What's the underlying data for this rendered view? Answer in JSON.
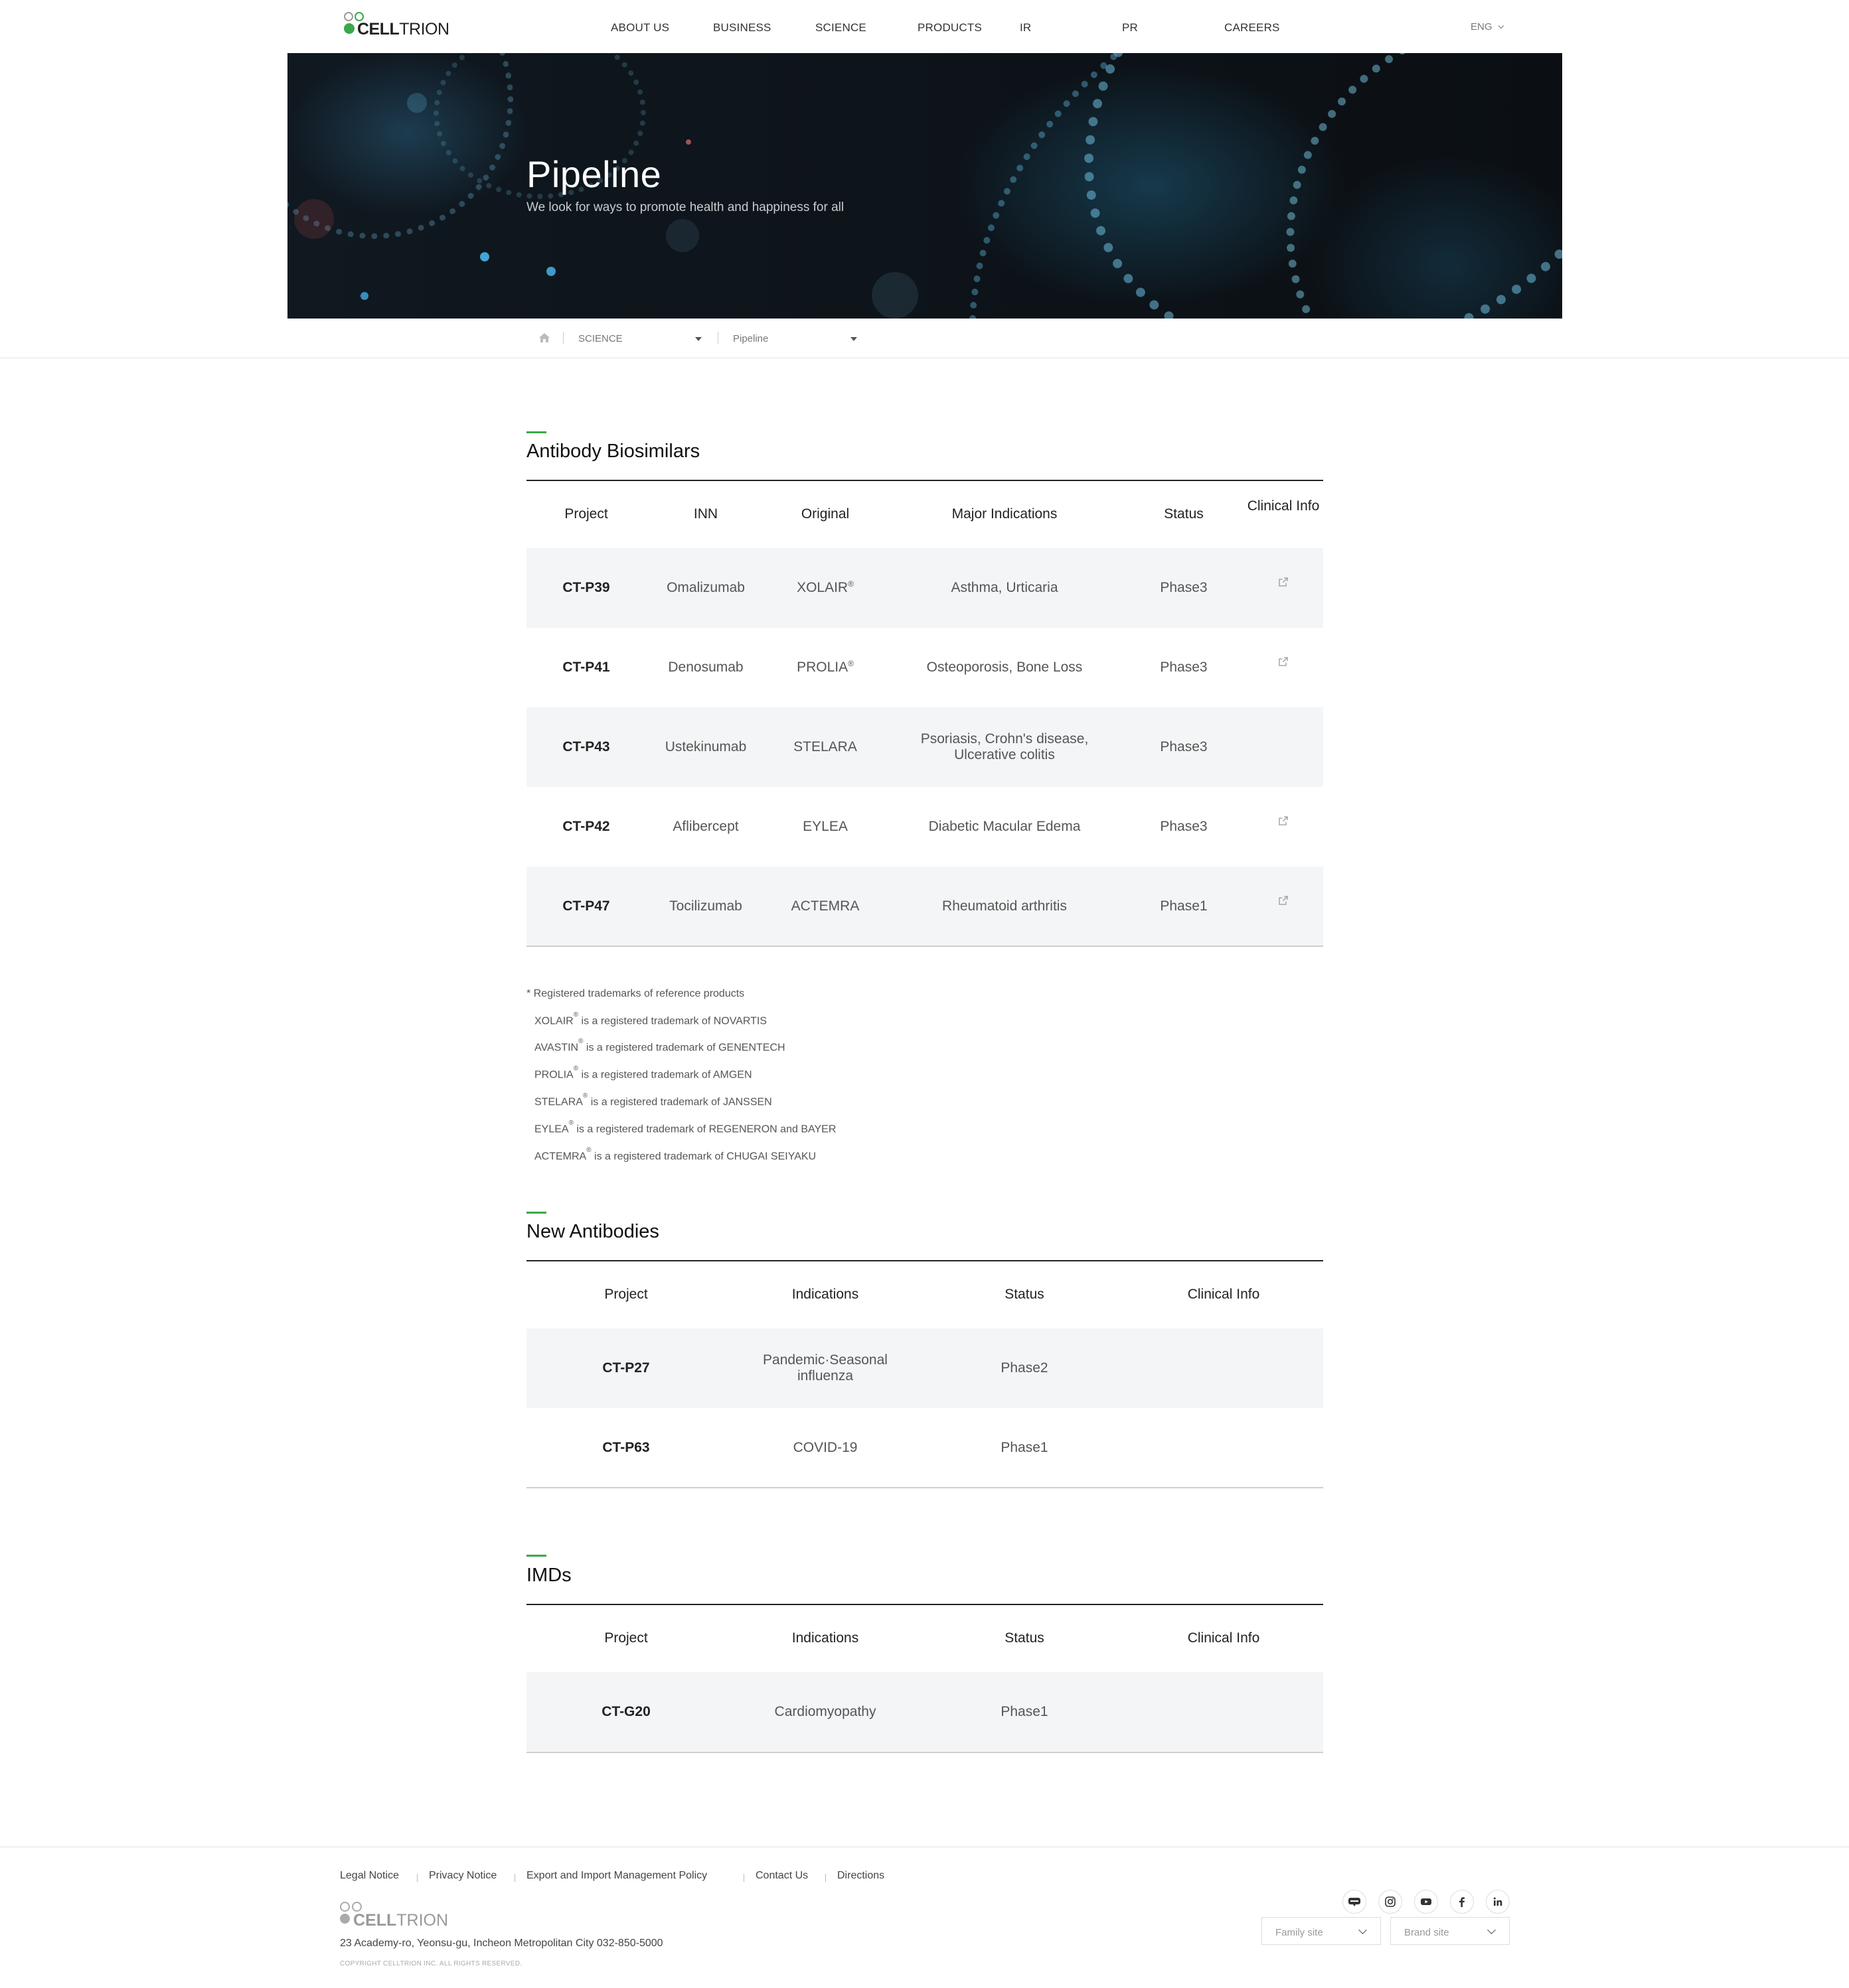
{
  "header": {
    "logo_text_bold": "CELL",
    "logo_text_light": "TRION",
    "nav": [
      "ABOUT US",
      "BUSINESS",
      "SCIENCE",
      "PRODUCTS",
      "IR",
      "PR",
      "CAREERS"
    ],
    "language": "ENG"
  },
  "hero": {
    "title": "Pipeline",
    "subtitle": "We look for ways to promote health and happiness for all"
  },
  "breadcrumb": {
    "level1": "SCIENCE",
    "level2": "Pipeline"
  },
  "biosimilars": {
    "title": "Antibody Biosimilars",
    "headers": [
      "Project",
      "INN",
      "Original",
      "Major Indications",
      "Status",
      "Clinical Info"
    ],
    "rows": [
      {
        "project": "CT-P39",
        "inn": "Omalizumab",
        "original": "XOLAIR",
        "reg": "®",
        "indications": "Asthma, Urticaria",
        "status": "Phase3",
        "clinical_link": true
      },
      {
        "project": "CT-P41",
        "inn": "Denosumab",
        "original": "PROLIA",
        "reg": "®",
        "indications": "Osteoporosis, Bone Loss",
        "status": "Phase3",
        "clinical_link": true
      },
      {
        "project": "CT-P43",
        "inn": "Ustekinumab",
        "original": "STELARA",
        "reg": "",
        "indications": "Psoriasis, Crohn's disease, Ulcerative colitis",
        "status": "Phase3",
        "clinical_link": false
      },
      {
        "project": "CT-P42",
        "inn": "Aflibercept",
        "original": "EYLEA",
        "reg": "",
        "indications": "Diabetic Macular Edema",
        "status": "Phase3",
        "clinical_link": true
      },
      {
        "project": "CT-P47",
        "inn": "Tocilizumab",
        "original": "ACTEMRA",
        "reg": "",
        "indications": "Rheumatoid arthritis",
        "status": "Phase1",
        "clinical_link": true
      }
    ]
  },
  "trademark_notes": {
    "heading": "* Registered trademarks of reference products",
    "lines": [
      {
        "brand": "XOLAIR",
        "text": " is a registered trademark of NOVARTIS"
      },
      {
        "brand": "AVASTIN",
        "text": " is a registered trademark of GENENTECH"
      },
      {
        "brand": "PROLIA",
        "text": " is a registered trademark of AMGEN"
      },
      {
        "brand": "STELARA",
        "text": " is a registered trademark of JANSSEN"
      },
      {
        "brand": "EYLEA",
        "text": " is a registered trademark of REGENERON and BAYER"
      },
      {
        "brand": "ACTEMRA",
        "text": " is a registered trademark of CHUGAI SEIYAKU"
      }
    ],
    "reg_mark": "®"
  },
  "new_antibodies": {
    "title": "New Antibodies",
    "headers": [
      "Project",
      "Indications",
      "Status",
      "Clinical Info"
    ],
    "rows": [
      {
        "project": "CT-P27",
        "indications": "Pandemic·Seasonal influenza",
        "status": "Phase2"
      },
      {
        "project": "CT-P63",
        "indications": "COVID-19",
        "status": "Phase1"
      }
    ]
  },
  "imds": {
    "title": "IMDs",
    "headers": [
      "Project",
      "Indications",
      "Status",
      "Clinical Info"
    ],
    "rows": [
      {
        "project": "CT-G20",
        "indications": "Cardiomyopathy",
        "status": "Phase1"
      }
    ]
  },
  "footer": {
    "links": [
      "Legal Notice",
      "Privacy Notice",
      "Export and Import Management Policy",
      "Contact Us",
      "Directions"
    ],
    "address": "23 Academy-ro, Yeonsu-gu, Incheon Metropolitan City   032-850-5000",
    "copyright": "COPYRIGHT CELLTRION INC. ALL RIGHTS RESERVED.",
    "social": [
      "blog-icon",
      "instagram-icon",
      "youtube-icon",
      "facebook-icon",
      "linkedin-icon"
    ],
    "family_site": "Family site",
    "brand_site": "Brand site"
  },
  "colors": {
    "accent": "#3aa84a",
    "row_gray": "#f4f5f6"
  }
}
